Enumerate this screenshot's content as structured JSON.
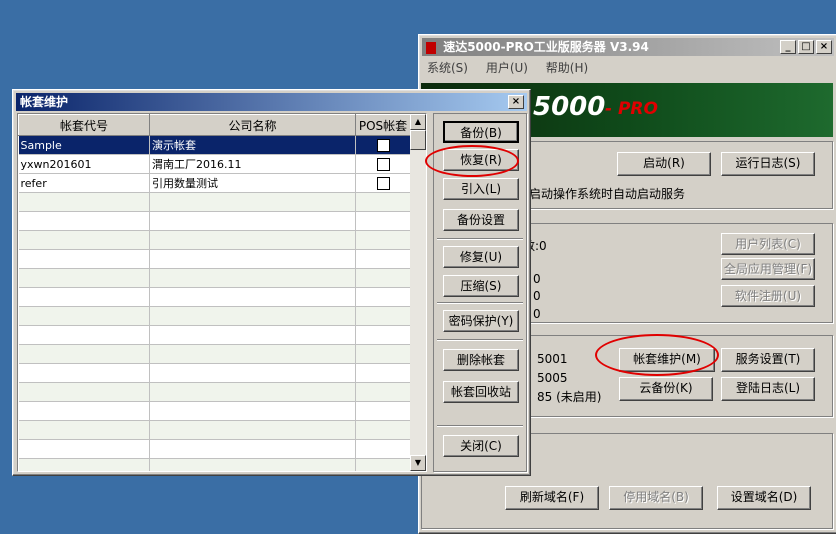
{
  "server": {
    "title": "速达5000-PRO工业版服务器 V3.94",
    "menu": [
      "系统(S)",
      "用户(U)",
      "帮助(H)"
    ],
    "banner": "5000",
    "banner_sub": "- PRO",
    "btn_start": "启动(R)",
    "btn_runlog": "运行日志(S)",
    "autostart_text": "启动操作系统时自动启动服务",
    "stats_label": "数:0",
    "stat_values": [
      "0",
      "0",
      "0"
    ],
    "btn_user_list": "用户列表(C)",
    "btn_global_app": "全局应用管理(F)",
    "btn_software_reg": "软件注册(U)",
    "port1": "5001",
    "port2": "5005",
    "port3": "85 (未启用)",
    "btn_acct_maint": "帐套维护(M)",
    "btn_service_settings": "服务设置(T)",
    "btn_cloud_backup": "云备份(K)",
    "btn_login_log": "登陆日志(L)",
    "btn_refresh_domain": "刷新域名(F)",
    "btn_disable_domain": "停用域名(B)",
    "btn_set_domain": "设置域名(D)"
  },
  "dialog": {
    "title": "帐套维护",
    "columns": [
      "帐套代号",
      "公司名称",
      "POS帐套"
    ],
    "rows": [
      {
        "code": "Sample",
        "name": "演示帐套",
        "pos": false
      },
      {
        "code": "yxwn201601",
        "name": "渭南工厂2016.11",
        "pos": false
      },
      {
        "code": "refer",
        "name": "引用数量测试",
        "pos": false
      }
    ],
    "buttons": {
      "backup": "备份(B)",
      "restore": "恢复(R)",
      "import": "引入(L)",
      "backup_settings": "备份设置",
      "repair": "修复(U)",
      "compress": "压缩(S)",
      "password": "密码保护(Y)",
      "delete": "删除帐套",
      "recycle": "帐套回收站",
      "close": "关闭(C)"
    }
  }
}
